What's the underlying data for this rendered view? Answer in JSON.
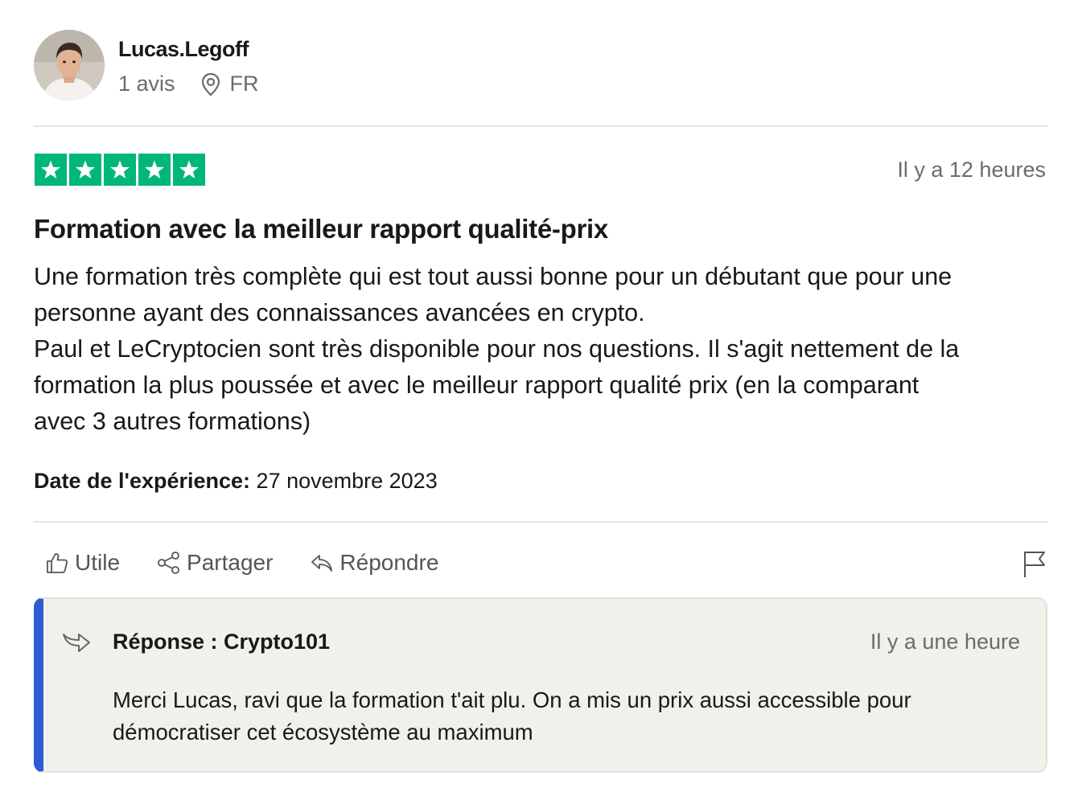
{
  "reviewer": {
    "name": "Lucas.Legoff",
    "review_count": "1 avis",
    "country": "FR"
  },
  "review": {
    "rating": 5,
    "time_ago": "Il y a 12 heures",
    "title": "Formation avec la meilleur rapport qualité-prix",
    "body_lines": [
      "Une formation très complète qui est tout aussi bonne pour un débutant que pour une",
      "personne ayant des connaissances avancées en crypto.",
      "Paul et LeCryptocien sont très disponible pour nos questions. Il s'agit nettement de la",
      "formation la plus poussée et avec le meilleur rapport qualité prix (en la comparant",
      "avec 3 autres formations)"
    ],
    "experience_label": "Date de l'expérience:",
    "experience_date": " 27 novembre 2023"
  },
  "actions": {
    "useful": "Utile",
    "share": "Partager",
    "reply": "Répondre"
  },
  "reply": {
    "title": "Réponse : Crypto101",
    "time_ago": "Il y a une heure",
    "text_lines": [
      "Merci Lucas, ravi que la formation t'ait plu. On a mis un prix aussi accessible pour",
      "démocratiser cet écosystème au maximum"
    ]
  },
  "colors": {
    "star_green": "#00b67a",
    "reply_accent": "#2e5bd3",
    "reply_background": "#f1f0eb"
  },
  "icons": [
    "user-avatar",
    "location-pin-icon",
    "star-icon",
    "thumbs-up-icon",
    "share-icon",
    "reply-arrow-icon",
    "flag-icon",
    "reply-arrow-icon"
  ]
}
